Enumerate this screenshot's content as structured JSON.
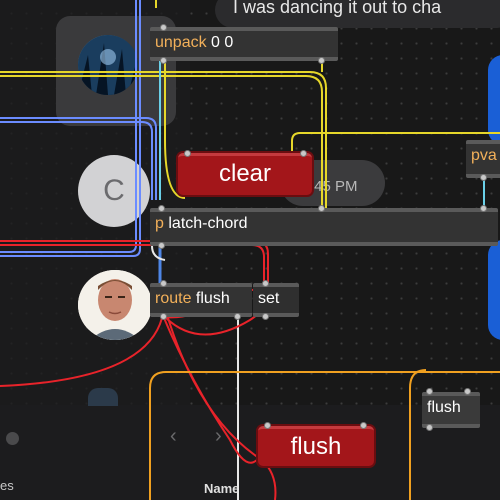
{
  "chat": {
    "message_text": "I was dancing it out to cha",
    "timestamp": ":45 PM",
    "contact_initial": "C"
  },
  "patcher": {
    "unpack": {
      "classname": "unpack",
      "args": "0 0"
    },
    "pvar": {
      "label": "pva"
    },
    "latch": {
      "prefix": "p",
      "name": "latch-chord"
    },
    "route": {
      "classname": "route",
      "args": "flush"
    },
    "set": {
      "label": "set"
    },
    "clear_msg": {
      "label": "clear"
    },
    "flush_msg": {
      "label": "flush"
    },
    "flush_obj": {
      "label": "flush"
    }
  },
  "bottom": {
    "nav_back": "‹",
    "nav_forward": "›",
    "name_header": "Name",
    "sidebar_label": "es"
  },
  "colors": {
    "canvas": "#181818",
    "object_bg": "#333333",
    "message_red": "#a3161a",
    "cord_yellow": "#e6d72a",
    "cord_red": "#e8232a",
    "cord_blue": "#6b8cff",
    "cord_orange": "#f0a020",
    "cord_cyan": "#6ad0e8",
    "accent_blue": "#1a5fd6"
  }
}
